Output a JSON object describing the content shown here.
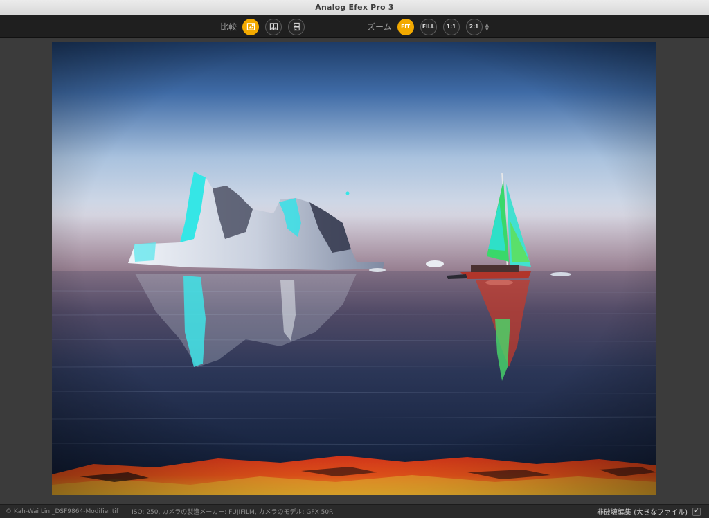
{
  "window": {
    "title": "Analog Efex Pro 3"
  },
  "toolbar": {
    "compare_label": "比較",
    "compare_buttons": [
      {
        "icon": "single-view-icon",
        "active": true
      },
      {
        "icon": "split-view-icon",
        "active": false
      },
      {
        "icon": "side-by-side-view-icon",
        "active": false
      }
    ],
    "zoom_label": "ズーム",
    "zoom_buttons": [
      {
        "label": "FIT",
        "active": true
      },
      {
        "label": "FILL",
        "active": false
      },
      {
        "label": "1:1",
        "active": false
      },
      {
        "label": "2:1",
        "active": false
      }
    ],
    "zoom_stepper_up": "▲",
    "zoom_stepper_down": "▼"
  },
  "photo": {
    "description_icon": "preview-image"
  },
  "status": {
    "file": "© Kah-Wai Lin _DSF9864-Modifier.tif",
    "separator": "|",
    "exif": "ISO: 250, カメラの製造メーカー: FUJIFILM, カメラのモデル: GFX 50R",
    "nondestructive_label": "非破壊編集 (大きなファイル)",
    "nondestructive_checked": "✓"
  },
  "colors": {
    "accent": "#f2a900",
    "toolbar_bg": "#1f1f1f",
    "canvas_bg": "#3b3b3b"
  }
}
